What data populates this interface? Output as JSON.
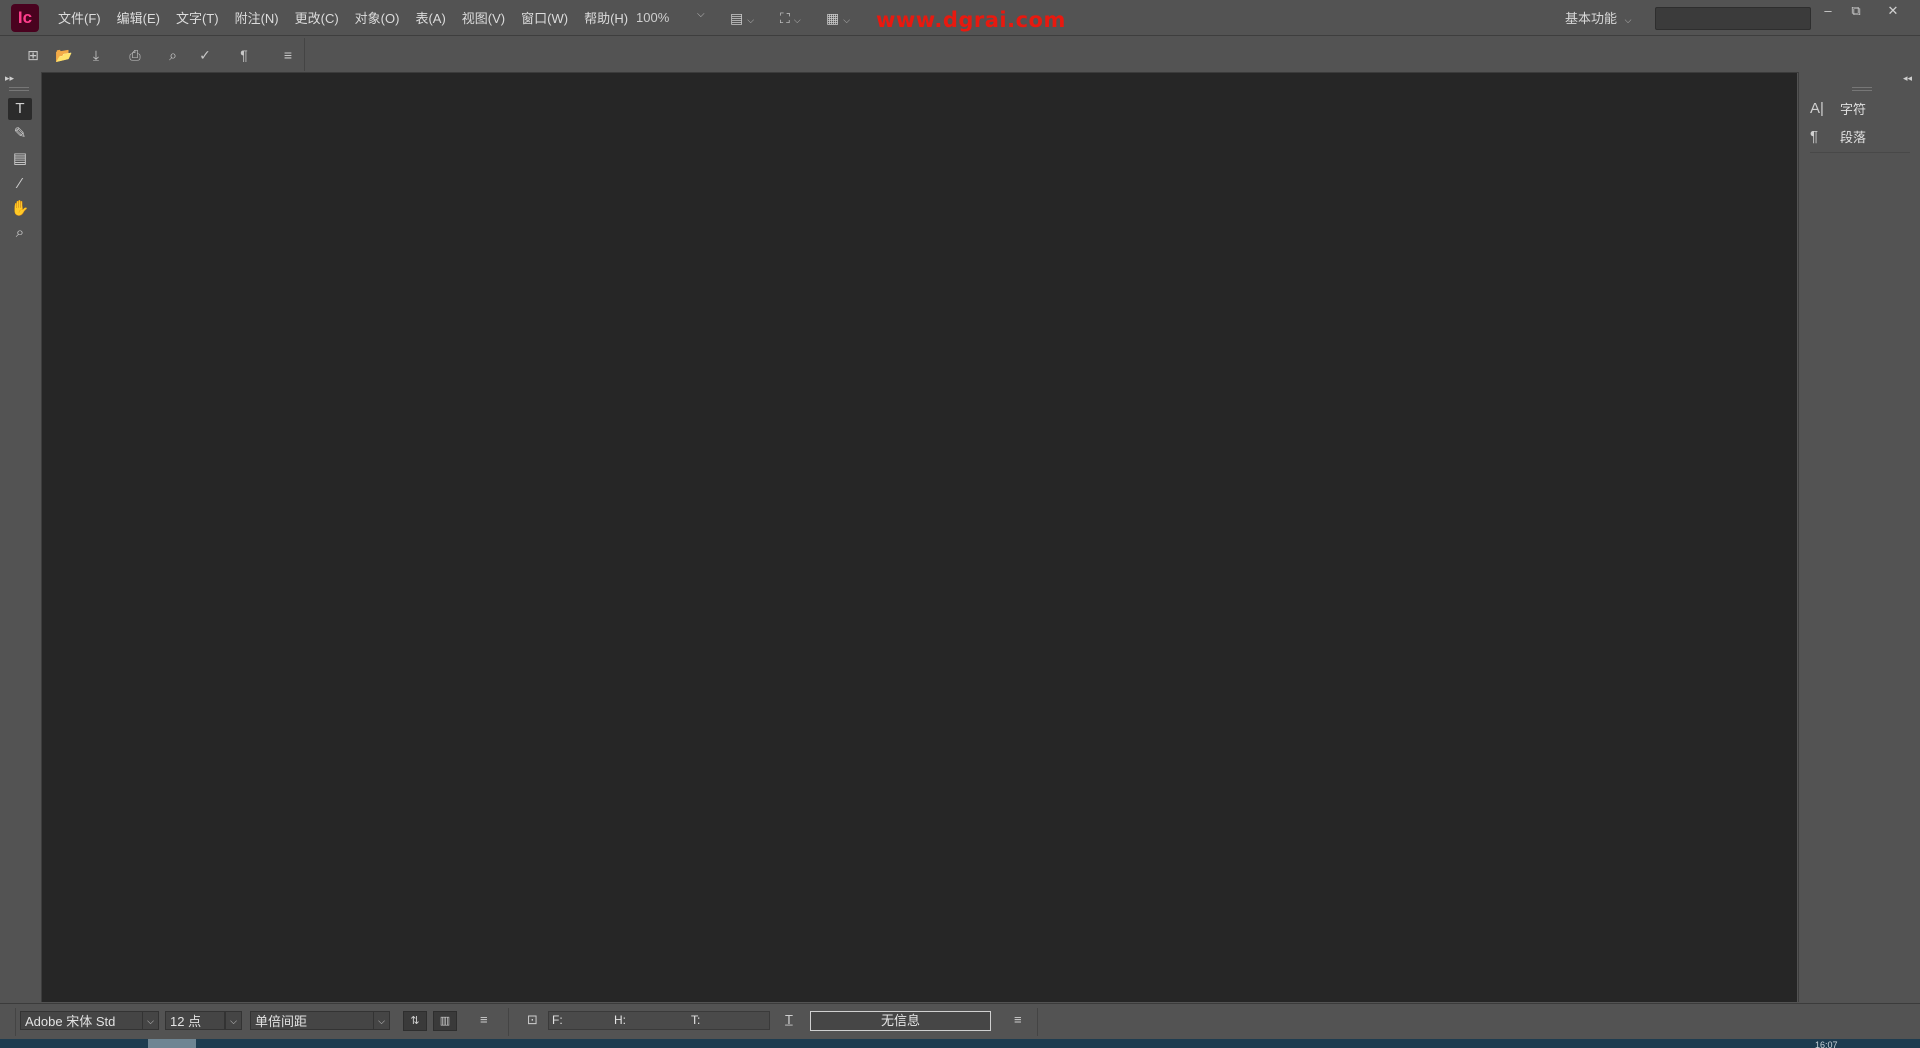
{
  "app": {
    "logo_text": "Ic"
  },
  "menu": {
    "items": [
      "文件(F)",
      "编辑(E)",
      "文字(T)",
      "附注(N)",
      "更改(C)",
      "对象(O)",
      "表(A)",
      "视图(V)",
      "窗口(W)",
      "帮助(H)"
    ]
  },
  "toolbar": {
    "zoom": "100%",
    "watermark": "www.dgrai.com",
    "workspace": "基本功能",
    "search_placeholder": ""
  },
  "right_panel": {
    "items": [
      {
        "label": "字符",
        "icon": "character-icon"
      },
      {
        "label": "段落",
        "icon": "paragraph-icon"
      }
    ]
  },
  "bottom_bar": {
    "font": "Adobe 宋体 Std",
    "size": "12 点",
    "spacing": "单倍间距",
    "f_label": "F:",
    "h_label": "H:",
    "t_label": "T:",
    "info": "无信息"
  },
  "taskbar": {
    "clock": "16:07"
  }
}
